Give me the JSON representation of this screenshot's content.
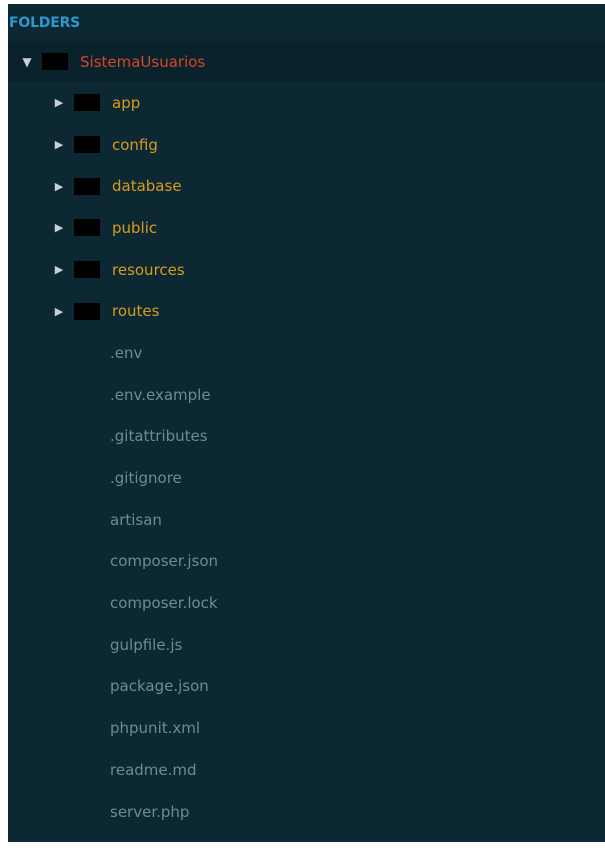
{
  "header": {
    "label": "FOLDERS"
  },
  "root": {
    "name": "SistemaUsuarios",
    "expanded": true,
    "arrow": "▼"
  },
  "folders": [
    {
      "name": "app",
      "arrow": "▶"
    },
    {
      "name": "config",
      "arrow": "▶"
    },
    {
      "name": "database",
      "arrow": "▶"
    },
    {
      "name": "public",
      "arrow": "▶"
    },
    {
      "name": "resources",
      "arrow": "▶"
    },
    {
      "name": "routes",
      "arrow": "▶"
    }
  ],
  "files": [
    {
      "name": ".env"
    },
    {
      "name": ".env.example"
    },
    {
      "name": ".gitattributes"
    },
    {
      "name": ".gitignore"
    },
    {
      "name": "artisan"
    },
    {
      "name": "composer.json"
    },
    {
      "name": "composer.lock"
    },
    {
      "name": "gulpfile.js"
    },
    {
      "name": "package.json"
    },
    {
      "name": "phpunit.xml"
    },
    {
      "name": "readme.md"
    },
    {
      "name": "server.php"
    }
  ],
  "colors": {
    "panel_bg": "#0c2832",
    "header": "#2f96d0",
    "root_label": "#d8432b",
    "folder_label": "#d99b1c",
    "file_label": "#6f8a93"
  }
}
